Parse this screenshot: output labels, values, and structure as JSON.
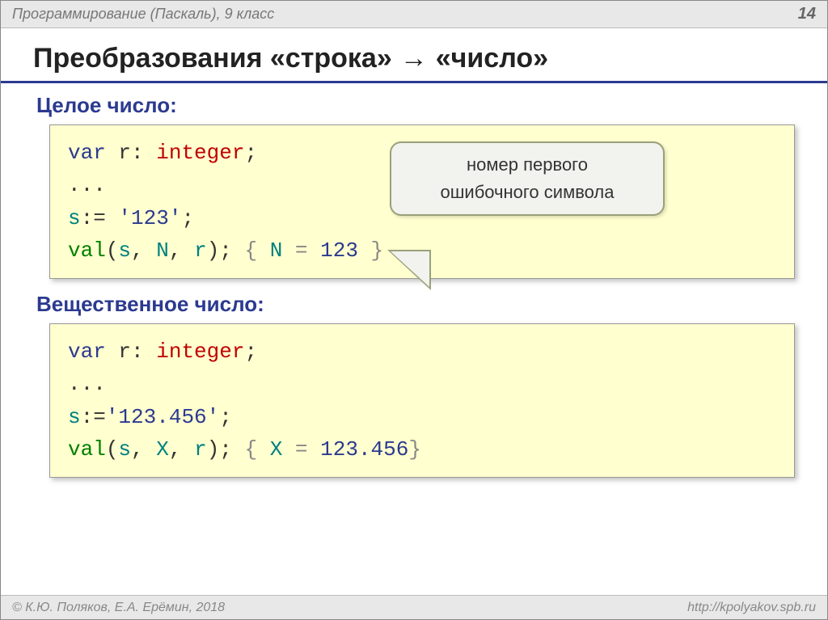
{
  "header": {
    "course": "Программирование (Паскаль), 9 класс",
    "page": "14"
  },
  "title": {
    "t1": "Преобразования «строка»",
    "arrow": "→",
    "t2": "«число»"
  },
  "section1": {
    "heading": "Целое число:",
    "code": {
      "l1a": "var",
      "l1b": " r: ",
      "l1c": "integer",
      "l1d": ";",
      "l2": "...",
      "l3a": "s",
      "l3b": ":= ",
      "l3c": "'123'",
      "l3d": ";",
      "l4a": "val",
      "l4b": "(",
      "l4c": "s",
      "l4d": ", ",
      "l4e": "N",
      "l4f": ", ",
      "l4g": "r",
      "l4h": "); ",
      "l4i": "{ ",
      "l4j": "N",
      "l4k": " = ",
      "l4l": "123",
      "l4m": " }"
    },
    "callout": {
      "line1": "номер первого",
      "line2": "ошибочного символа"
    }
  },
  "section2": {
    "heading": "Вещественное число:",
    "code": {
      "l1a": "var",
      "l1b": " r: ",
      "l1c": "integer",
      "l1d": ";",
      "l2": "...",
      "l3a": "s",
      "l3b": ":=",
      "l3c": "'123.456'",
      "l3d": ";",
      "l4a": "val",
      "l4b": "(",
      "l4c": "s",
      "l4d": ", ",
      "l4e": "X",
      "l4f": ", ",
      "l4g": "r",
      "l4h": "); ",
      "l4i": "{ ",
      "l4j": "X",
      "l4k": " = ",
      "l4l": "123.456",
      "l4m": "}"
    }
  },
  "footer": {
    "credit": "© К.Ю. Поляков, Е.А. Ерёмин, 2018",
    "url": "http://kpolyakov.spb.ru"
  }
}
